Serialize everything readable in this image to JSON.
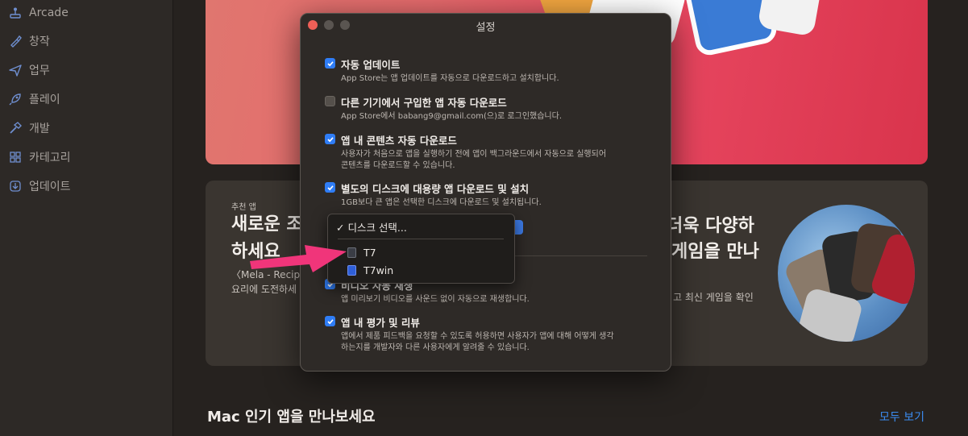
{
  "sidebar": {
    "items": [
      {
        "label": "Arcade",
        "icon": "joystick-icon"
      },
      {
        "label": "창작",
        "icon": "brush-icon"
      },
      {
        "label": "업무",
        "icon": "paper-plane-icon"
      },
      {
        "label": "플레이",
        "icon": "rocket-icon"
      },
      {
        "label": "개발",
        "icon": "hammer-icon"
      },
      {
        "label": "카테고리",
        "icon": "grid-icon"
      },
      {
        "label": "업데이트",
        "icon": "download-icon"
      }
    ]
  },
  "main": {
    "recommend": {
      "tag": "추천 앱",
      "title_line1": "새로운 조",
      "title_line2": "하세요",
      "desc_line1": "〈Mela - Recipe",
      "desc_line2": "요리에 도전하세",
      "right_line1": "더욱 다양하",
      "right_line2": "게임을 만나",
      "right_desc": "고 최신 게임을 확인"
    },
    "section_title": "Mac 인기 앱을 만나보세요",
    "see_all": "모두 보기"
  },
  "dialog": {
    "title": "설정",
    "options": [
      {
        "label": "자동 업데이트",
        "checked": true,
        "desc": [
          "App Store는 앱 업데이트를 자동으로 다운로드하고 설치합니다."
        ]
      },
      {
        "label": "다른 기기에서 구입한 앱 자동 다운로드",
        "checked": false,
        "desc": [
          "App Store에서 babang9@gmail.com(으)로 로그인했습니다."
        ]
      },
      {
        "label": "앱 내 콘텐츠 자동 다운로드",
        "checked": true,
        "desc": [
          "사용자가 처음으로 앱을 실행하기 전에 앱이 백그라운드에서 자동으로 실행되어",
          "콘텐츠를 다운로드할 수 있습니다."
        ]
      },
      {
        "label": "별도의 디스크에 대용량 앱 다운로드 및 설치",
        "checked": true,
        "desc": [
          "1GB보다 큰 앱은 선택한 디스크에 다운로드 및 설치됩니다."
        ]
      },
      {
        "label": "비디오 자동 재생",
        "checked": true,
        "desc": [
          "앱 미리보기 비디오를 사운드 없이 자동으로 재생합니다."
        ]
      },
      {
        "label": "앱 내 평가 및 리뷰",
        "checked": true,
        "desc": [
          "앱에서 제품 피드백을 요청할 수 있도록 허용하면 사용자가 앱에 대해 어떻게 생각",
          "하는지를 개발자와 다른 사용자에게 알려줄 수 있습니다."
        ]
      }
    ]
  },
  "menu": {
    "selected": "✓ 디스크 선택...",
    "items": [
      {
        "label": "T7",
        "icon": "external-drive-icon"
      },
      {
        "label": "T7win",
        "icon": "external-drive-icon"
      }
    ]
  },
  "colors": {
    "accent": "#2f7df6",
    "annotation_arrow": "#f0357a",
    "close_button": "#ee5f57"
  }
}
